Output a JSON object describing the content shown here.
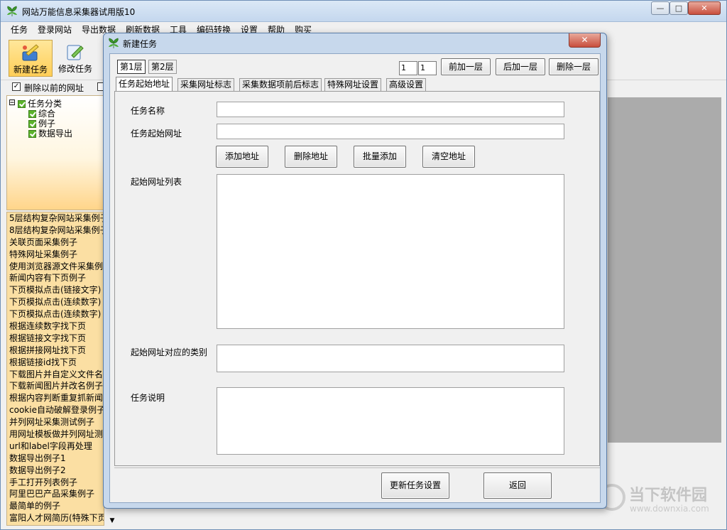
{
  "main_window": {
    "title": "网站万能信息采集器试用版10",
    "controls": {
      "minimize": "—",
      "maximize": "□",
      "close": "✕"
    }
  },
  "menu": [
    "任务",
    "登录网站",
    "导出数据",
    "刷新数据",
    "工具",
    "编码转换",
    "设置",
    "帮助",
    "购买"
  ],
  "toolbar": {
    "new_task": "新建任务",
    "edit_task": "修改任务"
  },
  "options": {
    "delete_previous_urls": "删除以前的网址",
    "delete_previous_checked": true
  },
  "tree": {
    "root": "任务分类",
    "children": [
      "综合",
      "例子",
      "数据导出"
    ]
  },
  "example_list": [
    "5层结构复杂网站采集例子",
    "8层结构复杂网站采集例子",
    "关联页面采集例子",
    "特殊网址采集例子",
    "使用浏览器源文件采集例",
    "新闻内容有下页例子",
    "下页模拟点击(链接文字)",
    "下页模拟点击(连续数字)",
    "下页模拟点击(连续数字)",
    "根据连续数字找下页",
    "根据链接文字找下页",
    "根据拼接网址找下页",
    "根据链接id找下页",
    "下载图片并自定义文件名",
    "下载新闻图片并改名例子",
    "根据内容判断重复抓新闻",
    "cookie自动破解登录例子",
    "并列网址采集测试例子",
    "用网址模板做并列网址测",
    "url和label字段再处理",
    "数据导出例子1",
    "数据导出例子2",
    "手工打开列表例子",
    "阿里巴巴产品采集例子",
    "最简单的例子",
    "富阳人才网简历(特殊下页"
  ],
  "dialog": {
    "title": "新建任务",
    "close": "✕",
    "layer_tabs": [
      "第1层",
      "第2层"
    ],
    "layer_inputs": [
      "1",
      "1"
    ],
    "layer_buttons": {
      "prev": "前加一层",
      "next": "后加一层",
      "delete": "删除一层"
    },
    "tabs": [
      "任务起始地址",
      "采集网址标志",
      "采集数据项前后标志",
      "特殊网址设置",
      "高级设置"
    ],
    "active_tab": 0,
    "fields": {
      "task_name": {
        "label": "任务名称",
        "value": ""
      },
      "start_url": {
        "label": "任务起始网址",
        "value": ""
      },
      "url_list": {
        "label": "起始网址列表"
      },
      "url_category": {
        "label": "起始网址对应的类别"
      },
      "task_description": {
        "label": "任务说明"
      }
    },
    "url_buttons": {
      "add": "添加地址",
      "delete": "删除地址",
      "batch_add": "批量添加",
      "clear": "清空地址"
    },
    "footer_buttons": {
      "update": "更新任务设置",
      "back": "返回"
    }
  },
  "watermark": {
    "name": "当下软件园",
    "url": "www.downxia.com"
  }
}
